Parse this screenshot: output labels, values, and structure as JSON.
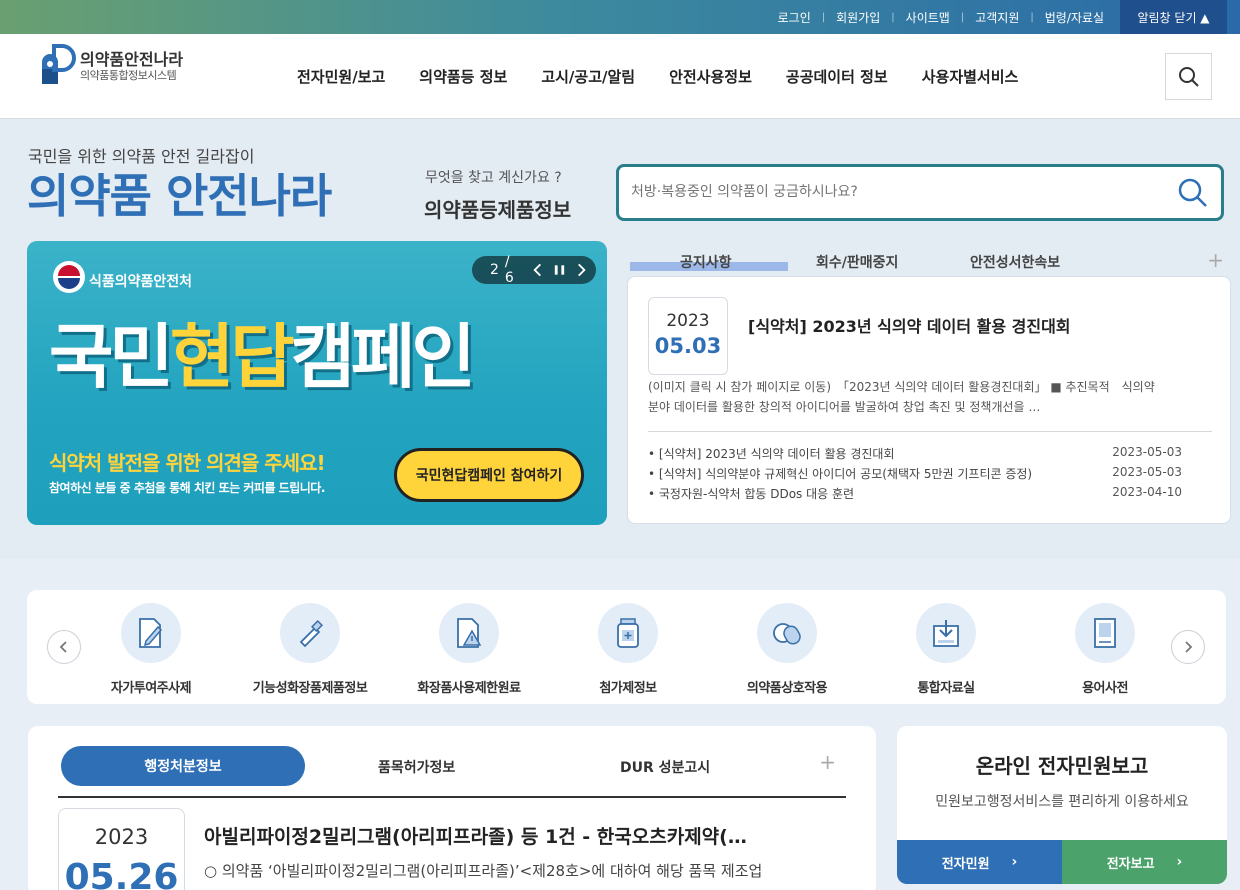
{
  "topbar": {
    "links": [
      "로그인",
      "회원가입",
      "사이트맵",
      "고객지원",
      "법령/자료실"
    ],
    "alarm": "알림창 닫기 ▲"
  },
  "logo": {
    "line1": "의약품안전나라",
    "line2": "의약품통합정보시스템"
  },
  "gnb": [
    "전자민원/보고",
    "의약품등 정보",
    "고시/공고/알림",
    "안전사용정보",
    "공공데이터 정보",
    "사용자별서비스"
  ],
  "hero": {
    "tagline": "국민을 위한 의약품 안전 길라잡이",
    "title": "의약품 안전나라",
    "ask": "무엇을 찾고 계신가요 ?",
    "ask_strong": "의약품등제품정보",
    "search_placeholder": "처방·복용중인 의약품이 궁금하시나요?"
  },
  "banner": {
    "org": "식품의약품안전처",
    "title_a": "국민",
    "title_b": "현답",
    "title_c": "캠페인",
    "sub1": "식약처 발전을 위한 의견을 주세요!",
    "sub2": "참여하신 분들 중 추첨을 통해 치킨 또는 커피를 드립니다.",
    "cta": "국민현답캠페인 참여하기",
    "pager_current": "2",
    "pager_total": "/ 6"
  },
  "notice": {
    "tabs": [
      "공지사항",
      "회수/판매중지",
      "안전성서한속보"
    ],
    "plus": "+",
    "year": "2023",
    "date": "05.03",
    "headline": "[식약처] 2023년 식의약 데이터 활용 경진대회",
    "desc": "(이미지 클릭 시 참가 페이지로 이동)　「2023년 식의약 데이터 활용경진대회」 ■ 추진목적　식의약 분야 데이터를 활용한 창의적 아이디어를 발굴하여 창업 촉진 및 정책개선을 …",
    "list": [
      {
        "title": "• [식약처] 2023년 식의약 데이터 활용 경진대회",
        "date": "2023-05-03"
      },
      {
        "title": "• [식약처] 식의약분야 규제혁신 아이디어 공모(채택자 5만권 기프티콘 증정)",
        "date": "2023-05-03"
      },
      {
        "title": "• 국정자원-식약처 합동 DDos 대응 훈련",
        "date": "2023-04-10"
      }
    ]
  },
  "quick": {
    "prev": "‹",
    "next": "›",
    "items": [
      {
        "label": "자가투여주사제",
        "icon": "pen-document-icon"
      },
      {
        "label": "기능성화장품제품정보",
        "icon": "cosmetic-tube-icon"
      },
      {
        "label": "화장품사용제한원료",
        "icon": "warning-document-icon"
      },
      {
        "label": "첨가제정보",
        "icon": "medicine-bottle-icon"
      },
      {
        "label": "의약품상호작용",
        "icon": "pill-capsule-icon"
      },
      {
        "label": "통합자료실",
        "icon": "download-box-icon"
      },
      {
        "label": "용어사전",
        "icon": "book-icon"
      }
    ]
  },
  "admin": {
    "tabs": [
      "행정처분정보",
      "품목허가정보",
      "DUR 성분고시"
    ],
    "plus": "+",
    "year": "2023",
    "date": "05.26",
    "headline": "아빌리파이정2밀리그램(아리피프라졸) 등 1건 - 한국오츠카제약(…",
    "desc": "○ 의약품 ‘아빌리파이정2밀리그램(아리피프라졸)’<제28호>에 대하여 해당 품목 제조업"
  },
  "minwon": {
    "title": "온라인 전자민원보고",
    "sub": "민원보고행정서비스를 편리하게 이용하세요",
    "btn1": "전자민원",
    "btn2": "전자보고",
    "chev": "›"
  },
  "colors": {
    "brand_blue": "#2f6fb5",
    "brand_green": "#4ba36b",
    "banner_teal": "#22a3bf",
    "banner_yellow": "#ffd43b"
  }
}
